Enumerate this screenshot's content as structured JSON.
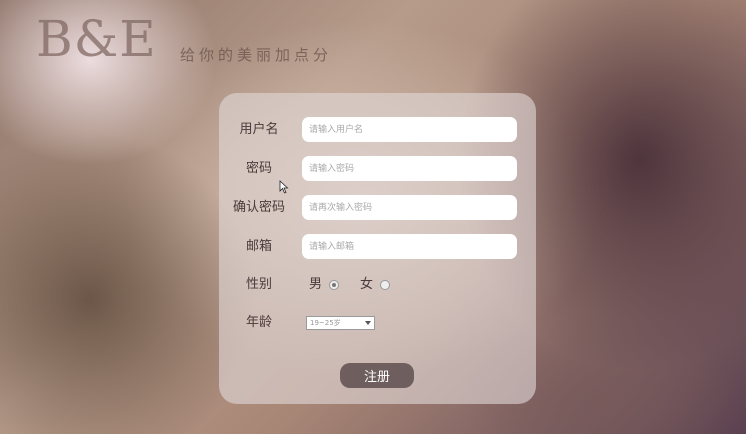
{
  "brand": {
    "logo": "B&E",
    "slogan": "给你的美丽加点分"
  },
  "form": {
    "username": {
      "label": "用户名",
      "placeholder": "请输入用户名"
    },
    "password": {
      "label": "密码",
      "placeholder": "请输入密码"
    },
    "confirm_password": {
      "label": "确认密码",
      "placeholder": "请再次输入密码"
    },
    "email": {
      "label": "邮箱",
      "placeholder": "请输入邮箱"
    },
    "gender": {
      "label": "性别",
      "options": [
        {
          "label": "男",
          "selected": true
        },
        {
          "label": "女",
          "selected": false
        }
      ]
    },
    "age": {
      "label": "年龄",
      "selected": "19~25岁"
    },
    "submit_label": "注册"
  }
}
